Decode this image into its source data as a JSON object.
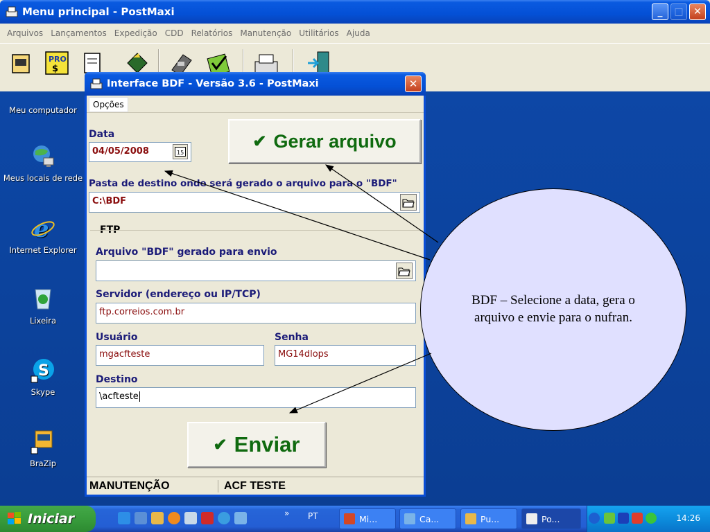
{
  "main_window": {
    "title": "Menu principal - PostMaxi",
    "menu": [
      "Arquivos",
      "Lançamentos",
      "Expedição",
      "CDD",
      "Relatórios",
      "Manutenção",
      "Utilitários",
      "Ajuda"
    ]
  },
  "desktop_icons": [
    {
      "label": "Meu computador",
      "icon": "my-computer-icon"
    },
    {
      "label": "Meus locais de rede",
      "icon": "network-places-icon"
    },
    {
      "label": "Internet Explorer",
      "icon": "internet-explorer-icon"
    },
    {
      "label": "Lixeira",
      "icon": "recycle-bin-icon"
    },
    {
      "label": "Skype",
      "icon": "skype-icon"
    },
    {
      "label": "BraZip",
      "icon": "brazip-icon"
    }
  ],
  "dialog": {
    "title": "Interface BDF - Versão 3.6 - PostMaxi",
    "menu_label": "Opções",
    "date_label": "Data",
    "date_value": "04/05/2008",
    "generate_button": "Gerar arquivo",
    "dest_folder_label": "Pasta de destino onde será gerado o arquivo para o \"BDF\"",
    "dest_folder_value": "C:\\BDF",
    "ftp_group": "FTP",
    "bdf_file_label": "Arquivo \"BDF\" gerado para envio",
    "bdf_file_value": "",
    "server_label": "Servidor (endereço ou IP/TCP)",
    "server_value": "ftp.correios.com.br",
    "user_label": "Usuário",
    "user_value": "mgacfteste",
    "password_label": "Senha",
    "password_value": "MG14dlops",
    "destination_label": "Destino",
    "destination_value": "\\acfteste",
    "send_button": "Enviar",
    "status_left": "MANUTENÇÃO",
    "status_right": "ACF TESTE"
  },
  "annotation": {
    "text": "BDF – Selecione a data, gera o arquivo e envie para o nufran."
  },
  "taskbar": {
    "start_label": "Iniciar",
    "language": "PT",
    "items": [
      "Mi...",
      "Ca...",
      "Pu...",
      "Po..."
    ],
    "clock": "14:26"
  },
  "colors": {
    "xp_blue": "#0450d6",
    "label_navy": "#1b1b78",
    "value_red": "#8a0d0d",
    "button_green": "#0f6a0f",
    "bubble_fill": "#e0e0ff"
  }
}
